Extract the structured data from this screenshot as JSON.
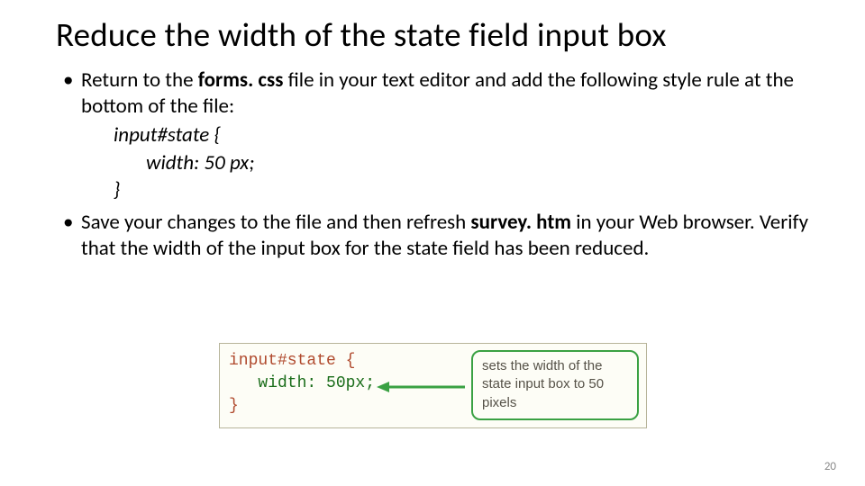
{
  "title": "Reduce the width of the state field input box",
  "bullets": {
    "b1_pre": "Return to the ",
    "b1_file": "forms. css",
    "b1_post": " file in your text editor and add the following style rule at the bottom of the file:",
    "b2_pre": "Save your changes to the file and then refresh ",
    "b2_file": "survey. htm",
    "b2_post": " in your Web browser. Verify that the width of the input box for the state field has been reduced."
  },
  "code": {
    "l1": "input#state {",
    "l2": "width: 50 px;",
    "l3": "}"
  },
  "figure": {
    "selector": "input#state",
    "brace_open": " {",
    "prop_indent": "   ",
    "prop": "width: 50px;",
    "brace_close": "}",
    "callout": "sets the width of the state input box to 50 pixels"
  },
  "page_number": "20"
}
